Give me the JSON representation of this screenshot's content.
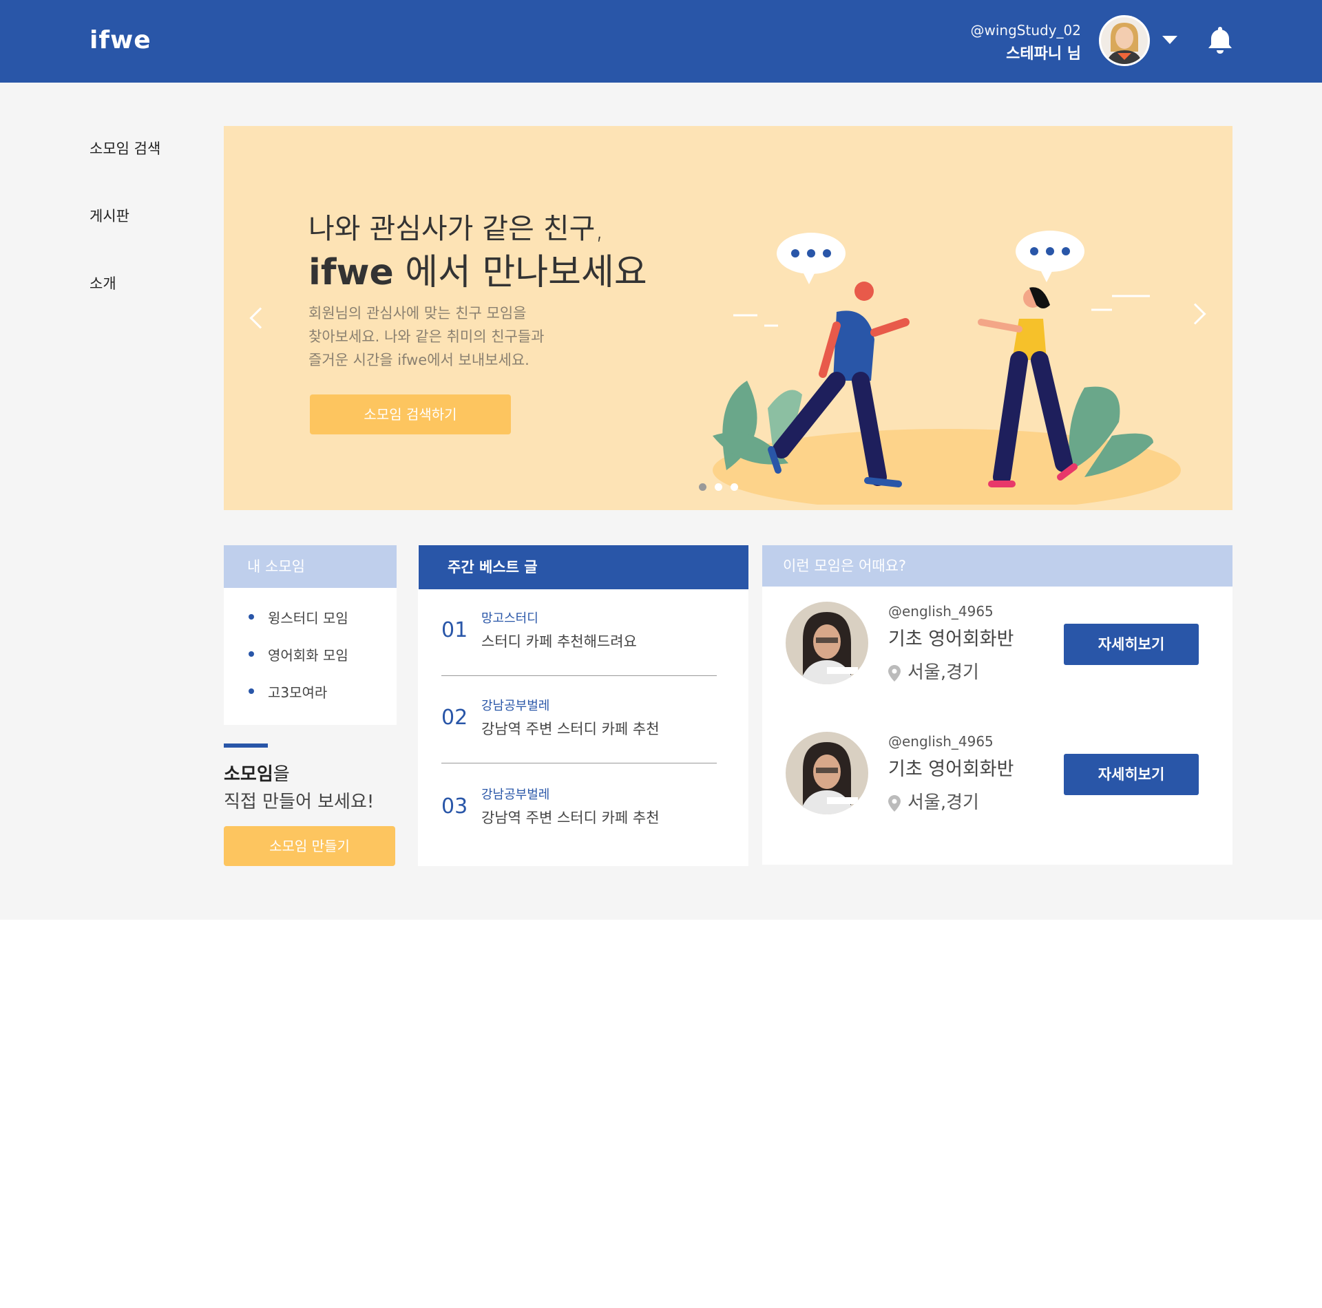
{
  "header": {
    "logo": "ifwe",
    "user_id": "@wingStudy_02",
    "user_name": "스테파니 님"
  },
  "sidenav": {
    "items": [
      {
        "label": "소모임 검색"
      },
      {
        "label": "게시판"
      },
      {
        "label": "소개"
      }
    ]
  },
  "hero": {
    "line1": "나와 관심사가 같은 친구,",
    "line2_brand": "ifwe",
    "line2_rest": " 에서 만나보세요",
    "desc_line1": "회원님의 관심사에 맞는 친구 모임을",
    "desc_line2": "찾아보세요. 나와 같은 취미의 친구들과",
    "desc_line3": "즐거운 시간을 ifwe에서 보내보세요.",
    "button": "소모임 검색하기",
    "slides_total": 3,
    "slide_active": 1
  },
  "my_groups": {
    "title": "내 소모임",
    "items": [
      {
        "label": "윙스터디 모임"
      },
      {
        "label": "영어회화 모임"
      },
      {
        "label": "고3모여라"
      }
    ]
  },
  "create": {
    "line1_bold": "소모임",
    "line1_rest": "을",
    "line2": "직접 만들어 보세요!",
    "button": "소모임 만들기"
  },
  "weekly_best": {
    "title": "주간 베스트 글",
    "posts": [
      {
        "num": "01",
        "category": "망고스터디",
        "title": "스터디 카페 추천해드려요"
      },
      {
        "num": "02",
        "category": "강남공부벌레",
        "title": "강남역 주변 스터디 카페 추천"
      },
      {
        "num": "03",
        "category": "강남공부벌레",
        "title": "강남역 주변 스터디 카페 추천"
      }
    ]
  },
  "suggest": {
    "title": "이런 모임은 어때요?",
    "groups": [
      {
        "user": "@english_4965",
        "name": "기초 영어회화반",
        "location": "서울,경기",
        "button": "자세히보기"
      },
      {
        "user": "@english_4965",
        "name": "기초 영어회화반",
        "location": "서울,경기",
        "button": "자세히보기"
      }
    ]
  },
  "colors": {
    "brand_blue": "#2956a8",
    "light_blue": "#bfcfec",
    "accent_yellow": "#fdc55f",
    "hero_bg": "#fde3b5",
    "page_bg": "#f5f5f5"
  },
  "icons": {
    "notification": "bell-icon",
    "dropdown": "caret-down-icon",
    "location": "map-pin-icon",
    "prev": "chevron-left-icon",
    "next": "chevron-right-icon"
  }
}
